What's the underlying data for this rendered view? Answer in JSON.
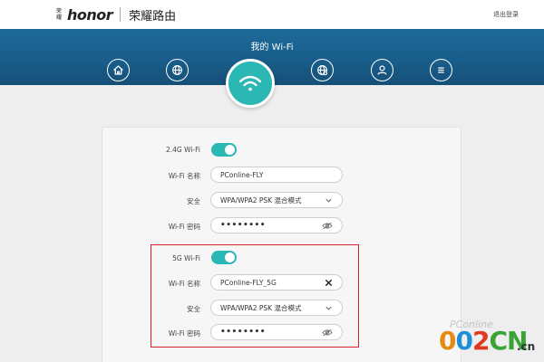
{
  "header": {
    "brand_mark": "荣耀",
    "brand_word": "honor",
    "product_title": "荣耀路由",
    "logout_label": "退出登录"
  },
  "nav": {
    "title": "我的 Wi-Fi",
    "items": [
      {
        "icon": "home-icon"
      },
      {
        "icon": "globe-icon"
      },
      {
        "icon": "wifi-icon",
        "active": true
      },
      {
        "icon": "globe-settings-icon"
      },
      {
        "icon": "user-icon"
      },
      {
        "icon": "menu-icon"
      }
    ]
  },
  "wifi24": {
    "label": "2.4G Wi-Fi",
    "enabled": true,
    "name_label": "Wi-Fi 名称",
    "name_value": "PConline-FLY",
    "security_label": "安全",
    "security_value": "WPA/WPA2 PSK 混合模式",
    "password_label": "Wi-Fi 密码",
    "password_value": "••••••••"
  },
  "wifi5": {
    "label": "5G Wi-Fi",
    "enabled": true,
    "name_label": "Wi-Fi 名称",
    "name_value": "PConline-FLY_5G",
    "security_label": "安全",
    "security_value": "WPA/WPA2 PSK 混合模式",
    "password_label": "Wi-Fi 密码",
    "password_value": "••••••••"
  },
  "watermark": {
    "faded_text": "PConline",
    "digits": [
      "0",
      "0",
      "2",
      "CN"
    ],
    "suffix": ".cn"
  },
  "colors": {
    "nav_band": "#195e8b",
    "accent_teal": "#2bb7b3",
    "highlight_red": "#d8212a"
  }
}
